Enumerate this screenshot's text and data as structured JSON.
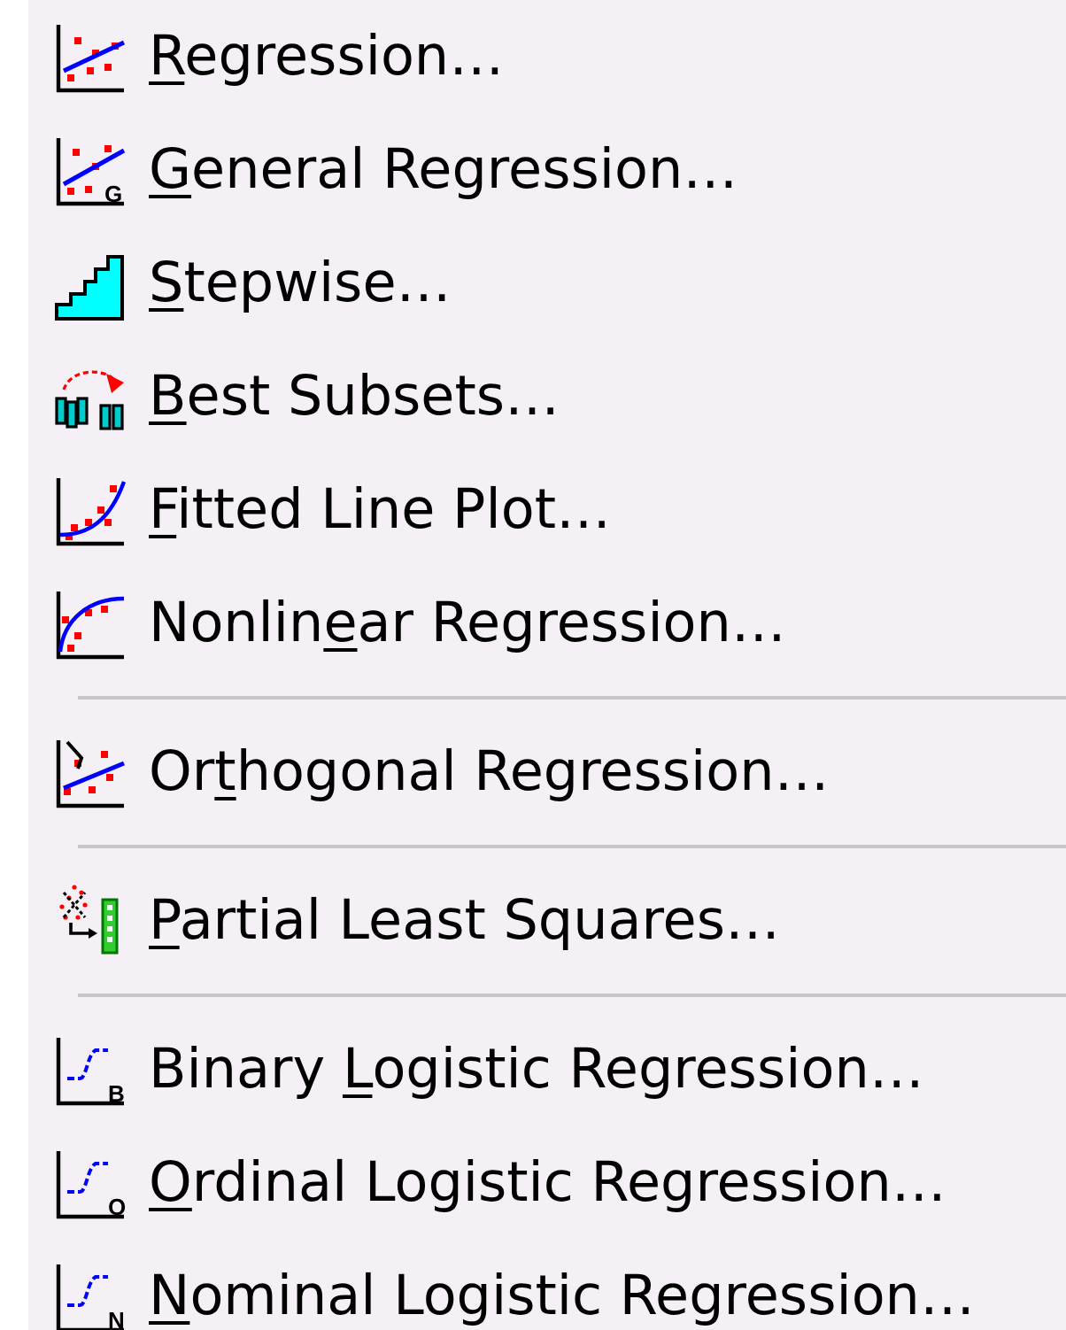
{
  "menu": {
    "entries": [
      {
        "kind": "item",
        "key": "R",
        "post": "egression…"
      },
      {
        "kind": "item",
        "icon_letter": "G",
        "key": "G",
        "post": "eneral Regression…"
      },
      {
        "kind": "item",
        "key": "S",
        "post": "tepwise…"
      },
      {
        "kind": "item",
        "key": "B",
        "post": "est Subsets…"
      },
      {
        "kind": "item",
        "key": "F",
        "post": "itted Line Plot…"
      },
      {
        "kind": "item",
        "pre": "Nonlin",
        "key": "e",
        "post": "ar Regression…"
      },
      {
        "kind": "separator"
      },
      {
        "kind": "item",
        "pre": "Or",
        "key": "t",
        "post": "hogonal Regression…"
      },
      {
        "kind": "separator"
      },
      {
        "kind": "item",
        "key": "P",
        "post": "artial Least Squares…"
      },
      {
        "kind": "separator"
      },
      {
        "kind": "item",
        "icon_letter": "B",
        "pre": "Binary ",
        "key": "L",
        "post": "ogistic Regression…"
      },
      {
        "kind": "item",
        "icon_letter": "O",
        "key": "O",
        "post": "rdinal Logistic Regression…"
      },
      {
        "kind": "item",
        "icon_letter": "N",
        "key": "N",
        "post": "ominal Logistic Regression…"
      }
    ]
  }
}
